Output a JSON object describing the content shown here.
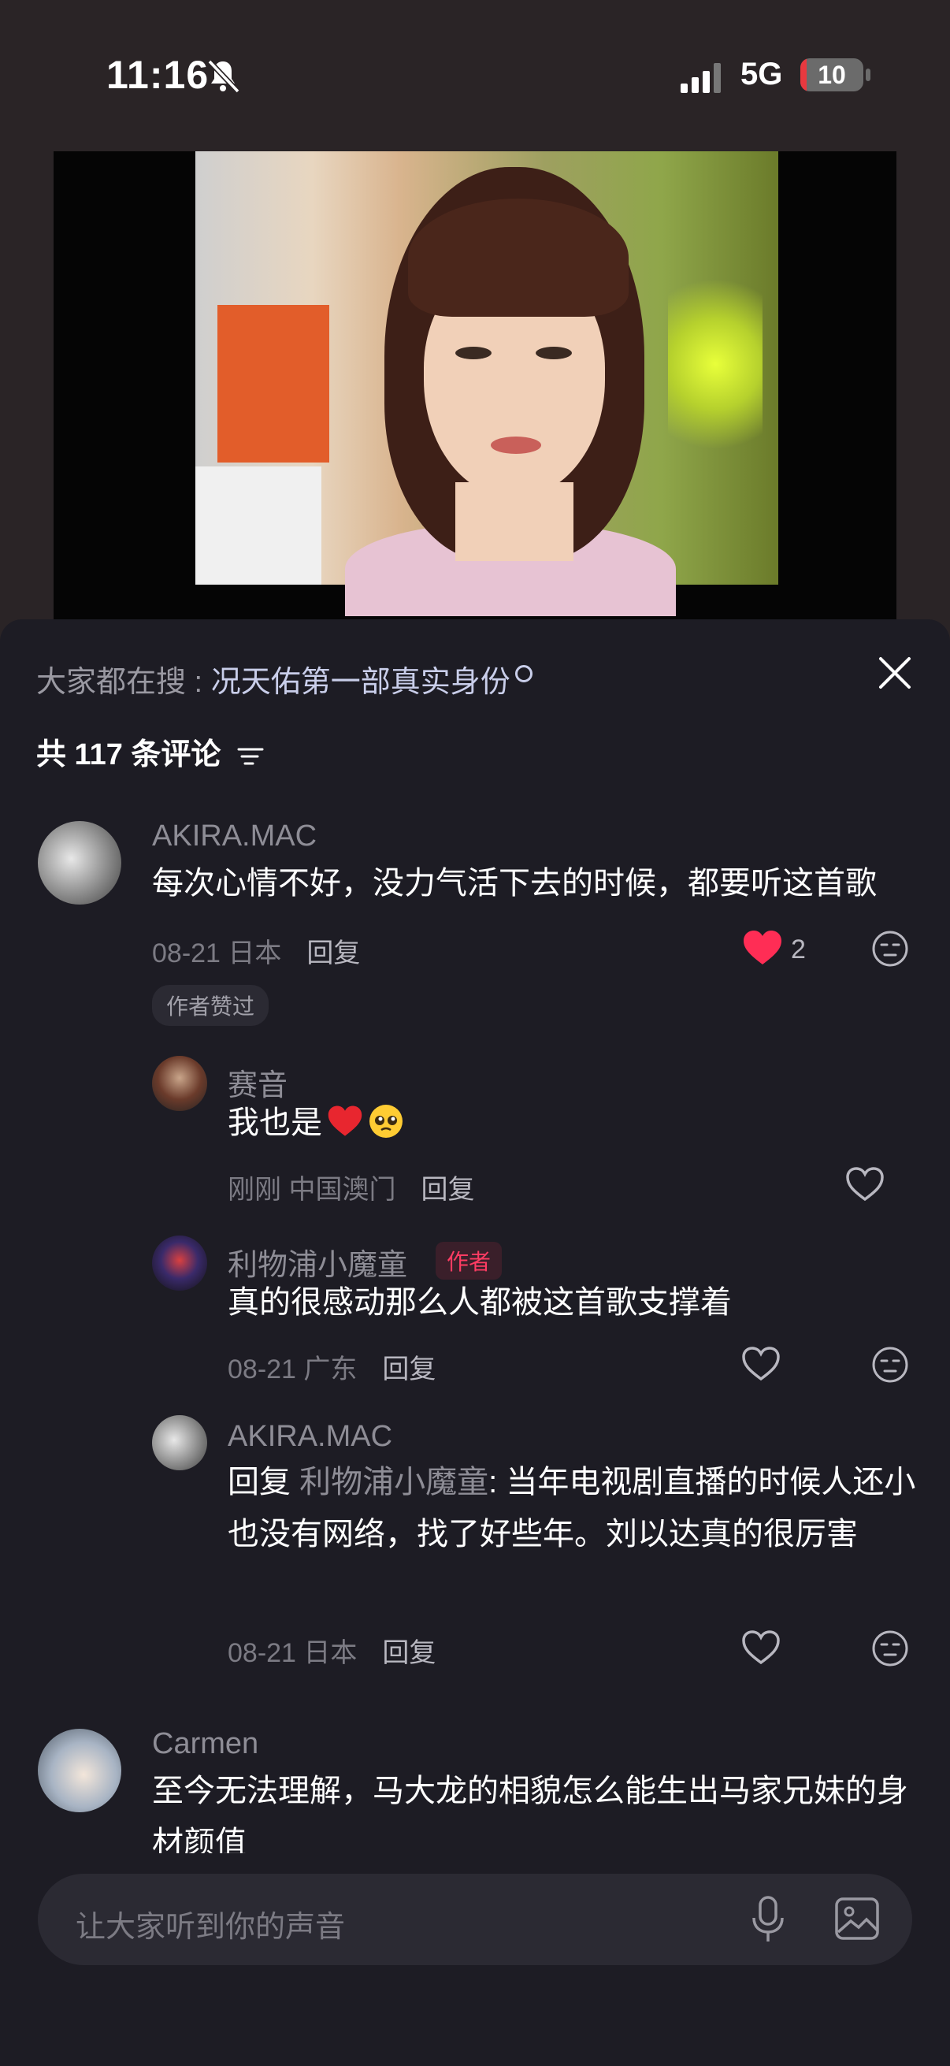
{
  "status_bar": {
    "time": "11:16",
    "network": "5G",
    "battery": "10",
    "battery_level": 0.1
  },
  "sheet": {
    "trending_prefix": "大家都在搜 : ",
    "trending_query": "况天佑第一部真实身份",
    "comment_count_label": "共 117 条评论"
  },
  "comments": [
    {
      "user": "AKIRA.MAC",
      "text": "每次心情不好，没力气活下去的时候，都要听这首歌",
      "date": "08-21 日本",
      "reply_label": "回复",
      "likes": "2",
      "badge": "作者赞过",
      "replies": [
        {
          "user": "赛音",
          "text": "我也是",
          "date": "刚刚 中国澳门",
          "reply_label": "回复"
        },
        {
          "user": "利物浦小魔童",
          "author_tag": "作者",
          "text": "真的很感动那么人都被这首歌支撑着",
          "date": "08-21 广东",
          "reply_label": "回复"
        },
        {
          "user": "AKIRA.MAC",
          "reply_prefix": "回复",
          "reply_to": "利物浦小魔童",
          "text": ": 当年电视剧直播的时候人还小也没有网络，找了好些年。刘以达真的很厉害",
          "date": "08-21 日本",
          "reply_label": "回复"
        }
      ]
    },
    {
      "user": "Carmen",
      "text": "至今无法理解，马大龙的相貌怎么能生出马家兄妹的身材颜值"
    }
  ],
  "input": {
    "placeholder": "让大家听到你的声音"
  },
  "colors": {
    "sheet_bg": "#1d1c24",
    "like_red": "#ff2d55",
    "author_pink": "#ff3c63",
    "link": "#c9ceea"
  }
}
